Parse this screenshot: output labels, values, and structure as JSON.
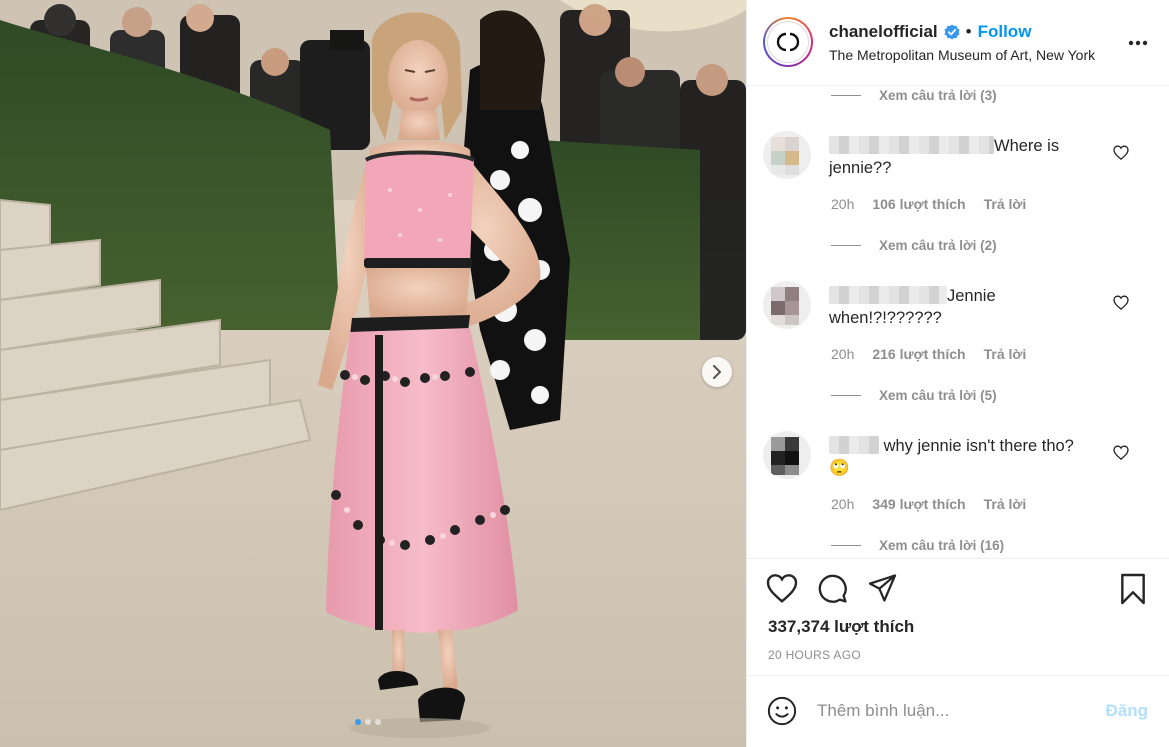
{
  "post": {
    "image_alt": "Woman in a pink sequined strapless crop top and long pink sequined skirt with black floral trim, posing on the stairs of The Metropolitan Museum of Art with photographers in the background",
    "carousel": {
      "total": 3,
      "active": 1
    },
    "icons": {
      "next": "chevron-right-icon"
    }
  },
  "header": {
    "username": "chanelofficial",
    "verified": true,
    "bullet": "•",
    "follow_label": "Follow",
    "location": "The Metropolitan Museum of Art, New York",
    "more_icon": "more-horizontal-icon",
    "avatar_logo": "CC"
  },
  "comments": {
    "replies_top": "Xem câu trả lời (3)",
    "items": [
      {
        "text": "Where is jennie??",
        "time": "20h",
        "likes": "106 lượt thích",
        "reply": "Trả lời",
        "view_replies": "Xem câu trả lời (2)"
      },
      {
        "text": "Jennie when!?!??????",
        "time": "20h",
        "likes": "216 lượt thích",
        "reply": "Trả lời",
        "view_replies": "Xem câu trả lời (5)"
      },
      {
        "text": "why jennie isn't there tho?",
        "emoji": "🙄",
        "time": "20h",
        "likes": "349 lượt thích",
        "reply": "Trả lời",
        "view_replies": "Xem câu trả lời (16)"
      }
    ]
  },
  "actions": {
    "like_icon": "heart-icon",
    "comment_icon": "comment-icon",
    "share_icon": "share-icon",
    "save_icon": "bookmark-icon",
    "likes_count": "337,374 lượt thích",
    "timestamp": "20 HOURS AGO"
  },
  "add_comment": {
    "emoji_icon": "smiley-icon",
    "placeholder": "Thêm bình luận...",
    "post_label": "Đăng"
  },
  "colors": {
    "accent": "#0095f6",
    "muted": "#8e8e8e",
    "post_disabled": "#b2dffc",
    "dress_pink": "#f2a7b8"
  }
}
